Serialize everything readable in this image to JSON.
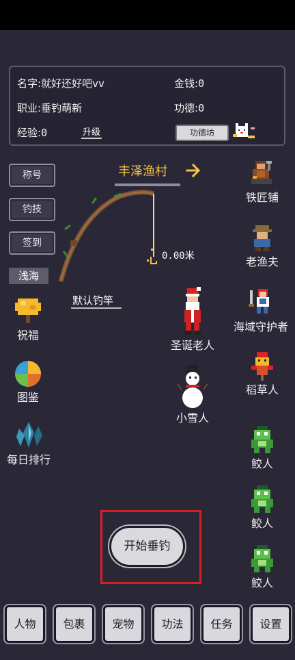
{
  "stats": {
    "name_label": "名字:",
    "name_value": "就好还好吧vv",
    "job_label": "职业:",
    "job_value": "垂钓萌新",
    "exp_label": "经验:",
    "exp_value": "0",
    "upgrade_label": "升级",
    "money_label": "金钱:",
    "money_value": "0",
    "merit_label": "功德:",
    "merit_value": "0",
    "merit_shop_label": "功德坊"
  },
  "side_buttons": [
    "称号",
    "钓技",
    "签到"
  ],
  "area_label": "浅海",
  "village_label": "丰泽渔村",
  "distance": "0.00米",
  "rod_name": "默认钓竿",
  "left_menu": [
    "祝福",
    "图鉴",
    "每日排行"
  ],
  "center_npcs": [
    "圣诞老人",
    "小雪人"
  ],
  "right_npcs": [
    "铁匠铺",
    "老渔夫",
    "海域守护者",
    "稻草人",
    "鲛人",
    "鲛人",
    "鲛人"
  ],
  "start_label": "开始垂钓",
  "bottom_nav": [
    "人物",
    "包裹",
    "宠物",
    "功法",
    "任务",
    "设置"
  ]
}
